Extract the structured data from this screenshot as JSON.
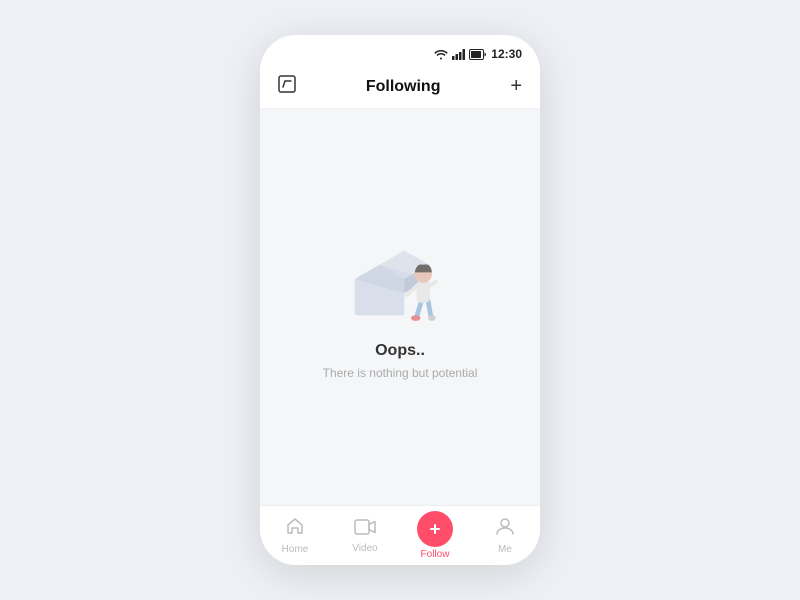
{
  "statusBar": {
    "time": "12:30"
  },
  "navbar": {
    "title": "Following",
    "editIcon": "✎",
    "addIcon": "+"
  },
  "emptyState": {
    "title": "Oops..",
    "subtitle": "There is nothing but potential"
  },
  "tabBar": {
    "items": [
      {
        "id": "home",
        "label": "Home",
        "active": false
      },
      {
        "id": "video",
        "label": "Video",
        "active": false
      },
      {
        "id": "follow",
        "label": "Follow",
        "active": true
      },
      {
        "id": "me",
        "label": "Me",
        "active": false
      }
    ]
  }
}
